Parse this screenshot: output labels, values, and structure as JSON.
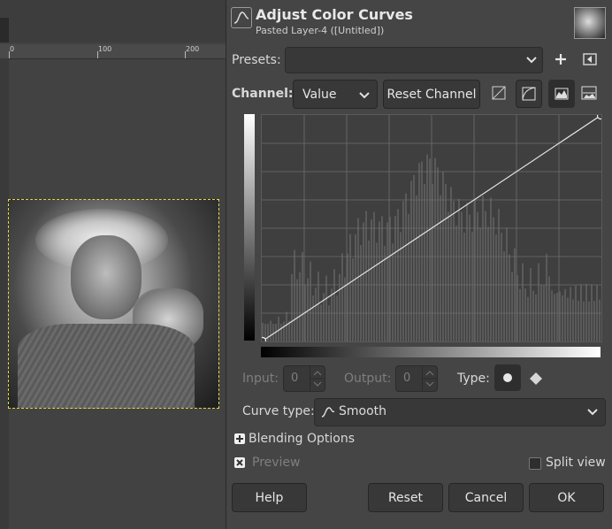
{
  "canvas": {
    "ruler_ticks": [
      "0",
      "100",
      "200"
    ]
  },
  "dialog": {
    "title": "Adjust Color Curves",
    "subtitle": "Pasted Layer-4 ([Untitled])",
    "presets_label": "Presets:",
    "presets_value": "",
    "channel_label": "Channel:",
    "channel_value": "Value",
    "reset_channel": "Reset Channel",
    "input_label": "Input:",
    "input_value": "0",
    "output_label": "Output:",
    "output_value": "0",
    "type_label": "Type:",
    "curve_type_label": "Curve type:",
    "curve_type_value": "Smooth",
    "blending_options": "Blending Options",
    "preview_label": "Preview",
    "split_view_label": "Split view",
    "buttons": {
      "help": "Help",
      "reset": "Reset",
      "cancel": "Cancel",
      "ok": "OK"
    },
    "icons": {
      "title": "curves-icon",
      "add_preset": "plus-icon",
      "preset_menu": "arrow-left-icon",
      "linear_histogram": "linear-histogram-icon",
      "log_histogram": "log-histogram-icon",
      "smooth_point": "circle-point-icon",
      "corner_point": "diamond-point-icon",
      "curve_type": "smooth-curve-icon"
    }
  }
}
